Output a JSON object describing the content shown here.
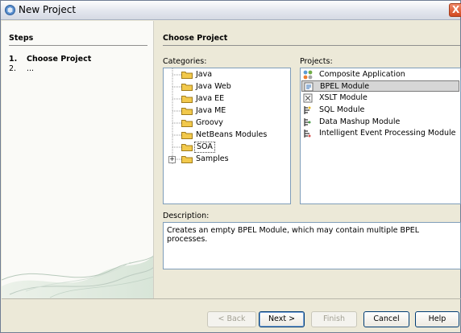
{
  "window": {
    "title": "New Project",
    "close_glyph": "X"
  },
  "steps": {
    "heading": "Steps",
    "items": [
      {
        "num": "1.",
        "label": "Choose Project",
        "active": true
      },
      {
        "num": "2.",
        "label": "...",
        "active": false
      }
    ]
  },
  "content": {
    "heading": "Choose Project",
    "categories_label": "Categories:",
    "projects_label": "Projects:",
    "description_label": "Description:",
    "description_text": "Creates an empty BPEL Module, which may contain multiple BPEL processes."
  },
  "categories": [
    {
      "label": "Java",
      "expander": ""
    },
    {
      "label": "Java Web",
      "expander": ""
    },
    {
      "label": "Java EE",
      "expander": ""
    },
    {
      "label": "Java ME",
      "expander": ""
    },
    {
      "label": "Groovy",
      "expander": ""
    },
    {
      "label": "NetBeans Modules",
      "expander": ""
    },
    {
      "label": "SOA",
      "expander": "",
      "selected": true
    },
    {
      "label": "Samples",
      "expander": "+"
    }
  ],
  "projects": [
    {
      "label": "Composite Application",
      "icon": "composite-app-icon"
    },
    {
      "label": "BPEL Module",
      "icon": "bpel-module-icon",
      "selected": true
    },
    {
      "label": "XSLT Module",
      "icon": "xslt-module-icon"
    },
    {
      "label": "SQL Module",
      "icon": "sql-module-icon"
    },
    {
      "label": "Data Mashup Module",
      "icon": "data-mashup-icon"
    },
    {
      "label": "Intelligent Event Processing Module",
      "icon": "iep-module-icon"
    }
  ],
  "buttons": {
    "back": "< Back",
    "next": "Next >",
    "finish": "Finish",
    "cancel": "Cancel",
    "help": "Help"
  },
  "colors": {
    "dialog_bg": "#ece9d8",
    "selection_bg": "#d6d6d6",
    "folder_yellow": "#f2c94c",
    "close_red": "#d24a22"
  }
}
